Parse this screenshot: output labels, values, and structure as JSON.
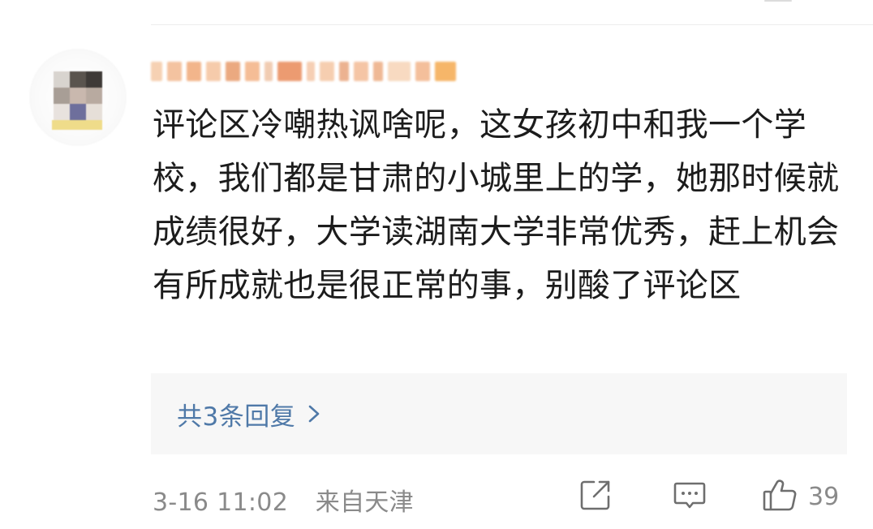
{
  "comment": {
    "username": "",
    "text": "评论区冷嘲热讽啥呢，这女孩初中和我一个学校，我们都是甘肃的小城里上的学，她那时候就成绩很好，大学读湖南大学非常优秀，赶上机会有所成就也是很正常的事，别酸了评论区",
    "reply_link": "共3条回复",
    "timestamp": "3-16 11:02",
    "location": "来自天津",
    "like_count": "39"
  },
  "icons": {
    "share": "share-icon",
    "comment": "comment-icon",
    "like": "thumbs-up-icon",
    "chevron": "chevron-right-icon"
  },
  "colors": {
    "text": "#1c1c1c",
    "link": "#4f79a8",
    "meta": "#8a8a8a",
    "reply_bg": "#f7f7f7",
    "icon": "#6e6e6e"
  }
}
